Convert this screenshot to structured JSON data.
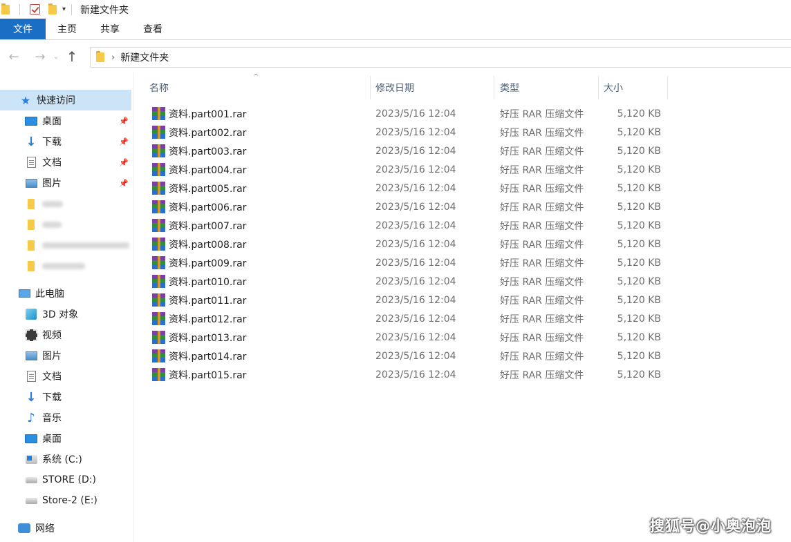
{
  "window": {
    "title": "新建文件夹"
  },
  "ribbon": {
    "tabs": [
      {
        "label": "文件",
        "active": true
      },
      {
        "label": "主页"
      },
      {
        "label": "共享"
      },
      {
        "label": "查看"
      }
    ]
  },
  "address": {
    "breadcrumb": "新建文件夹"
  },
  "sidebar": {
    "quick_access": {
      "label": "快速访问",
      "items": [
        {
          "label": "桌面",
          "icon": "desktop-icon",
          "pinned": true
        },
        {
          "label": "下载",
          "icon": "download-icon",
          "pinned": true
        },
        {
          "label": "文档",
          "icon": "document-icon",
          "pinned": true
        },
        {
          "label": "图片",
          "icon": "picture-icon",
          "pinned": true
        }
      ]
    },
    "this_pc": {
      "label": "此电脑",
      "items": [
        {
          "label": "3D 对象",
          "icon": "3d-objects-icon"
        },
        {
          "label": "视频",
          "icon": "video-icon"
        },
        {
          "label": "图片",
          "icon": "picture-icon"
        },
        {
          "label": "文档",
          "icon": "document-icon"
        },
        {
          "label": "下载",
          "icon": "download-icon"
        },
        {
          "label": "音乐",
          "icon": "music-icon"
        },
        {
          "label": "桌面",
          "icon": "desktop-icon"
        },
        {
          "label": "系统 (C:)",
          "icon": "system-drive-icon"
        },
        {
          "label": "STORE (D:)",
          "icon": "drive-icon"
        },
        {
          "label": "Store-2 (E:)",
          "icon": "drive-icon"
        }
      ]
    },
    "network": {
      "label": "网络"
    }
  },
  "file_list": {
    "columns": {
      "name": "名称",
      "date": "修改日期",
      "type": "类型",
      "size": "大小"
    },
    "rows": [
      {
        "name": "资料.part001.rar",
        "date": "2023/5/16 12:04",
        "type": "好压 RAR 压缩文件",
        "size": "5,120 KB"
      },
      {
        "name": "资料.part002.rar",
        "date": "2023/5/16 12:04",
        "type": "好压 RAR 压缩文件",
        "size": "5,120 KB"
      },
      {
        "name": "资料.part003.rar",
        "date": "2023/5/16 12:04",
        "type": "好压 RAR 压缩文件",
        "size": "5,120 KB"
      },
      {
        "name": "资料.part004.rar",
        "date": "2023/5/16 12:04",
        "type": "好压 RAR 压缩文件",
        "size": "5,120 KB"
      },
      {
        "name": "资料.part005.rar",
        "date": "2023/5/16 12:04",
        "type": "好压 RAR 压缩文件",
        "size": "5,120 KB"
      },
      {
        "name": "资料.part006.rar",
        "date": "2023/5/16 12:04",
        "type": "好压 RAR 压缩文件",
        "size": "5,120 KB"
      },
      {
        "name": "资料.part007.rar",
        "date": "2023/5/16 12:04",
        "type": "好压 RAR 压缩文件",
        "size": "5,120 KB"
      },
      {
        "name": "资料.part008.rar",
        "date": "2023/5/16 12:04",
        "type": "好压 RAR 压缩文件",
        "size": "5,120 KB"
      },
      {
        "name": "资料.part009.rar",
        "date": "2023/5/16 12:04",
        "type": "好压 RAR 压缩文件",
        "size": "5,120 KB"
      },
      {
        "name": "资料.part010.rar",
        "date": "2023/5/16 12:04",
        "type": "好压 RAR 压缩文件",
        "size": "5,120 KB"
      },
      {
        "name": "资料.part011.rar",
        "date": "2023/5/16 12:04",
        "type": "好压 RAR 压缩文件",
        "size": "5,120 KB"
      },
      {
        "name": "资料.part012.rar",
        "date": "2023/5/16 12:04",
        "type": "好压 RAR 压缩文件",
        "size": "5,120 KB"
      },
      {
        "name": "资料.part013.rar",
        "date": "2023/5/16 12:04",
        "type": "好压 RAR 压缩文件",
        "size": "5,120 KB"
      },
      {
        "name": "资料.part014.rar",
        "date": "2023/5/16 12:04",
        "type": "好压 RAR 压缩文件",
        "size": "5,120 KB"
      },
      {
        "name": "资料.part015.rar",
        "date": "2023/5/16 12:04",
        "type": "好压 RAR 压缩文件",
        "size": "5,120 KB"
      }
    ]
  },
  "watermark": "搜狐号@小奥泡泡",
  "colors": {
    "accent": "#1a6fc4",
    "selected_bg": "#cce4f7",
    "header_text": "#4c607a"
  }
}
